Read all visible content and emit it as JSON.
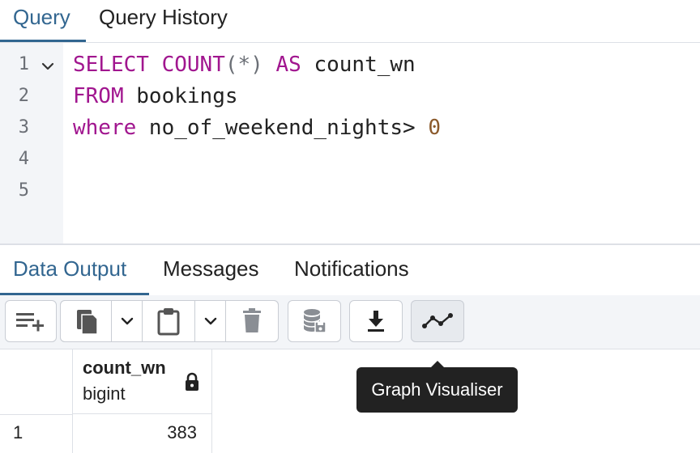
{
  "editor_tabs": [
    {
      "label": "Query",
      "active": true
    },
    {
      "label": "Query History",
      "active": false
    }
  ],
  "editor": {
    "line_numbers": [
      "1",
      "2",
      "3",
      "4",
      "5"
    ],
    "lines": [
      [
        {
          "t": "SELECT",
          "c": "kw"
        },
        {
          "t": " ",
          "c": "txt"
        },
        {
          "t": "COUNT",
          "c": "kw"
        },
        {
          "t": "(*)",
          "c": "punc"
        },
        {
          "t": " ",
          "c": "txt"
        },
        {
          "t": "AS",
          "c": "kw"
        },
        {
          "t": " count_wn",
          "c": "txt"
        }
      ],
      [
        {
          "t": "FROM",
          "c": "kw"
        },
        {
          "t": " bookings",
          "c": "txt"
        }
      ],
      [
        {
          "t": "where",
          "c": "kw"
        },
        {
          "t": " no_of_weekend_nights> ",
          "c": "txt"
        },
        {
          "t": "0",
          "c": "num"
        }
      ],
      [],
      []
    ]
  },
  "output_tabs": [
    {
      "label": "Data Output",
      "active": true
    },
    {
      "label": "Messages",
      "active": false
    },
    {
      "label": "Notifications",
      "active": false
    }
  ],
  "toolbar": {
    "buttons": [
      "add-row-icon",
      "copy-icon",
      "chevron-down-icon",
      "paste-icon",
      "chevron-down-icon",
      "delete-icon",
      "save-data-icon",
      "download-icon",
      "graph-icon"
    ]
  },
  "grid": {
    "columns": [
      {
        "name": "count_wn",
        "type": "bigint",
        "locked": true
      }
    ],
    "rows": [
      {
        "num": "1",
        "values": [
          "383"
        ]
      }
    ]
  },
  "tooltip": {
    "text": "Graph Visualiser"
  },
  "colors": {
    "accent": "#326690",
    "keyword": "#a1168f",
    "number": "#8b5a2b"
  }
}
